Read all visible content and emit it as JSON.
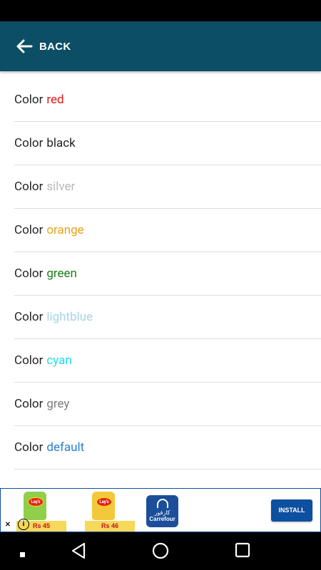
{
  "header": {
    "back_label": "BACK",
    "background": "#0b4e66"
  },
  "colors_list": [
    {
      "prefix": "Color",
      "name": "red",
      "hex": "#e21717"
    },
    {
      "prefix": "Color",
      "name": "black",
      "hex": "#222222"
    },
    {
      "prefix": "Color",
      "name": "silver",
      "hex": "#b8b8b8"
    },
    {
      "prefix": "Color",
      "name": "orange",
      "hex": "#e7a316"
    },
    {
      "prefix": "Color",
      "name": "green",
      "hex": "#1a7f1a"
    },
    {
      "prefix": "Color",
      "name": "lightblue",
      "hex": "#a8d3e6"
    },
    {
      "prefix": "Color",
      "name": "cyan",
      "hex": "#17e0ea"
    },
    {
      "prefix": "Color",
      "name": "grey",
      "hex": "#7d7d7d"
    },
    {
      "prefix": "Color",
      "name": "default",
      "hex": "#2a7fd0"
    }
  ],
  "ad": {
    "product1_brand": "Lay's",
    "product1_price": "Rs 45",
    "product1_bag_color": "#8fcf4a",
    "product2_brand": "Lay's",
    "product2_price": "Rs 46",
    "product2_bag_color": "#f3c93b",
    "brand_arabic": "كارفور",
    "brand_name": "Carrefour",
    "install_label": "INSTALL",
    "close_icon": "×",
    "info_icon": "i"
  },
  "nav": {
    "recents_icon": "square-icon",
    "home_icon": "circle-icon",
    "back_icon": "triangle-icon"
  }
}
